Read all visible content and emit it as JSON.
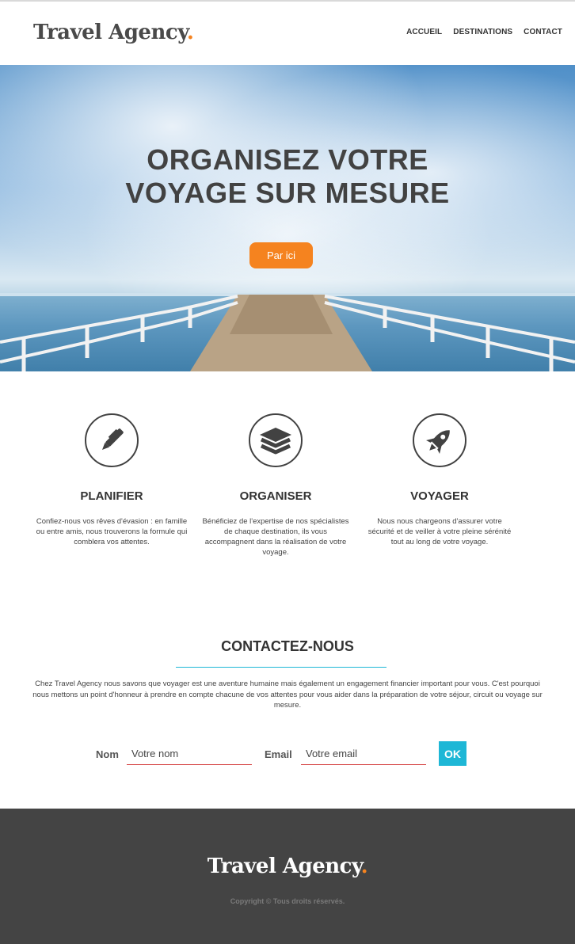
{
  "header": {
    "logo_text": "Travel Agency",
    "logo_dot": ".",
    "nav": [
      "ACCUEIL",
      "DESTINATIONS",
      "CONTACT"
    ]
  },
  "hero": {
    "title_line1": "ORGANISEZ VOTRE",
    "title_line2": "VOYAGE SUR MESURE",
    "cta_label": "Par ici"
  },
  "features": [
    {
      "icon": "pen-icon",
      "title": "PLANIFIER",
      "text": "Confiez-nous vos rêves d'évasion : en famille ou entre amis, nous trouverons la formule qui comblera vos attentes."
    },
    {
      "icon": "layers-icon",
      "title": "ORGANISER",
      "text": "Bénéficiez de l'expertise de nos spécialistes de chaque destination, ils vous accompagnent dans la réalisation de votre voyage."
    },
    {
      "icon": "rocket-icon",
      "title": "VOYAGER",
      "text": "Nous nous chargeons d'assurer votre sécurité et de veiller à votre pleine sérénité tout au long de votre voyage."
    }
  ],
  "contact": {
    "title": "CONTACTEZ-NOUS",
    "text": "Chez Travel Agency nous savons que voyager est une aventure humaine mais également un engagement financier important pour vous. C'est pourquoi nous mettons un point d'honneur à prendre en compte chacune de vos attentes pour vous aider dans la préparation de votre séjour, circuit ou voyage sur mesure.",
    "name_label": "Nom",
    "name_placeholder": "Votre nom",
    "email_label": "Email",
    "email_placeholder": "Votre email",
    "submit_label": "OK"
  },
  "footer": {
    "logo_text": "Travel Agency",
    "logo_dot": ".",
    "copyright": "Copyright © Tous droits réservés."
  },
  "colors": {
    "accent": "#f5831f",
    "secondary": "#1eb7d6",
    "footer_bg": "#444444",
    "text": "#424242"
  }
}
